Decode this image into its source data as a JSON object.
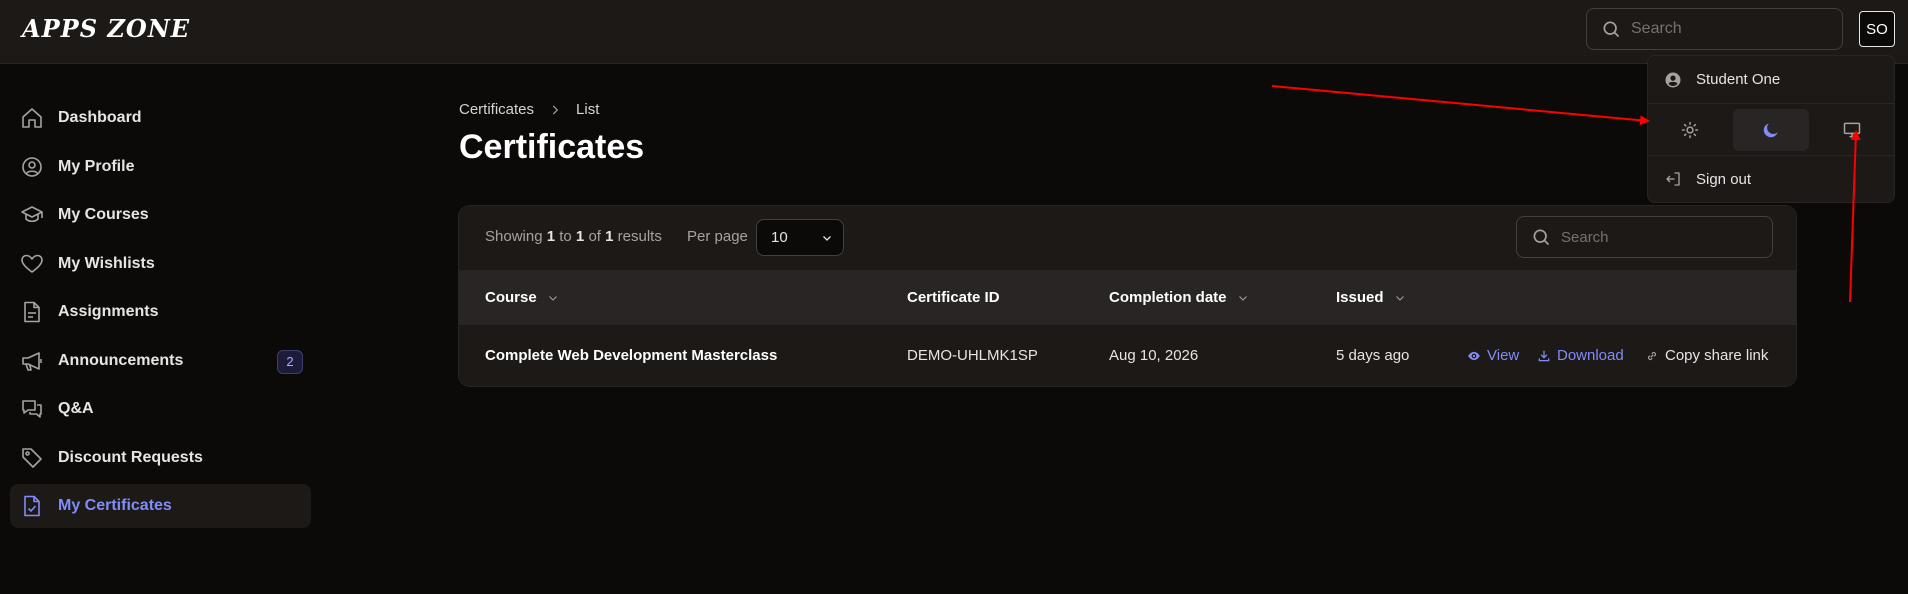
{
  "app": {
    "logo": "APPS ZONE",
    "avatar_initials": "SO"
  },
  "top_search": {
    "placeholder": "Search"
  },
  "sidebar": {
    "items": [
      {
        "label": "Dashboard",
        "icon": "home-icon"
      },
      {
        "label": "My Profile",
        "icon": "user-circle-icon"
      },
      {
        "label": "My Courses",
        "icon": "graduation-cap-icon"
      },
      {
        "label": "My Wishlists",
        "icon": "heart-icon"
      },
      {
        "label": "Assignments",
        "icon": "document-icon"
      },
      {
        "label": "Announcements",
        "icon": "megaphone-icon",
        "badge": "2"
      },
      {
        "label": "Q&A",
        "icon": "chat-bubbles-icon"
      },
      {
        "label": "Discount Requests",
        "icon": "tag-icon"
      },
      {
        "label": "My Certificates",
        "icon": "certificate-icon",
        "active": true
      }
    ]
  },
  "breadcrumb": {
    "parent": "Certificates",
    "current": "List"
  },
  "page_title": "Certificates",
  "table": {
    "showing_prefix": "Showing",
    "from": "1",
    "to_word": "to",
    "to": "1",
    "of_word": "of",
    "total": "1",
    "results_word": "results",
    "per_page_label": "Per page",
    "per_page_value": "10",
    "search_placeholder": "Search",
    "columns": {
      "course": "Course",
      "certificate_id": "Certificate ID",
      "completion_date": "Completion date",
      "issued": "Issued"
    },
    "rows": [
      {
        "course": "Complete Web Development Masterclass",
        "certificate_id": "DEMO-UHLMK1SP",
        "completion_date": "Aug 10, 2026",
        "issued": "5 days ago",
        "actions": {
          "view": "View",
          "download": "Download",
          "copy": "Copy share link"
        }
      }
    ]
  },
  "user_menu": {
    "name": "Student One",
    "themes": [
      "light",
      "dark",
      "system"
    ],
    "active_theme": "dark",
    "sign_out": "Sign out"
  },
  "colors": {
    "accent": "#818cf8",
    "annotation": "#ff0000",
    "background": "#0c0a09"
  }
}
